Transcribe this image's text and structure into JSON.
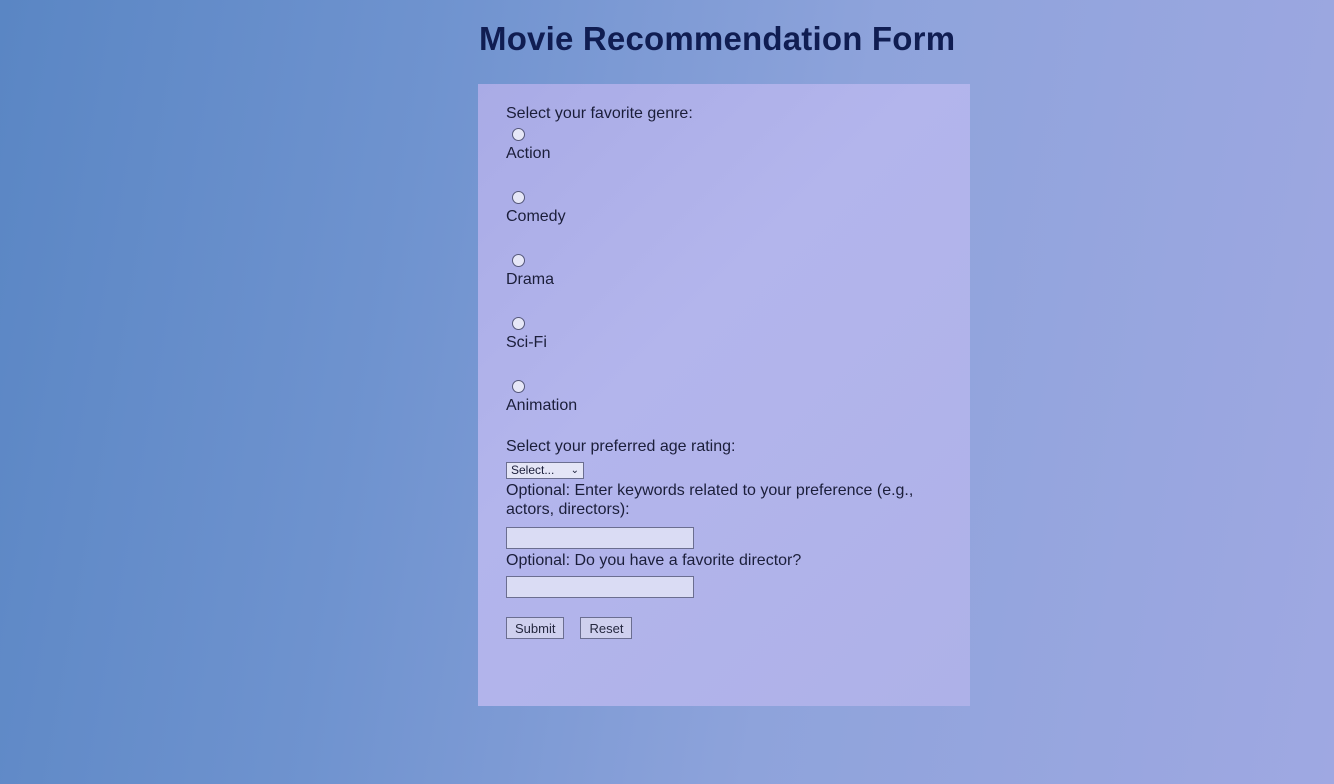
{
  "page": {
    "title": "Movie Recommendation Form"
  },
  "form": {
    "genre_heading": "Select your favorite genre:",
    "genres": [
      {
        "label": "Action",
        "selected": false
      },
      {
        "label": "Comedy",
        "selected": false
      },
      {
        "label": "Drama",
        "selected": false
      },
      {
        "label": "Sci-Fi",
        "selected": false
      },
      {
        "label": "Animation",
        "selected": false
      }
    ],
    "age_heading": "Select your preferred age rating:",
    "age_select_value": "Select...",
    "keywords_label": "Optional: Enter keywords related to your preference (e.g., actors, directors):",
    "keywords_value": "",
    "director_label": "Optional: Do you have a favorite director?",
    "director_value": "",
    "submit_label": "Submit",
    "reset_label": "Reset"
  },
  "colors": {
    "title": "#101d52",
    "card_background": "#b0b2ea"
  },
  "icons": {
    "select_arrow": "chevron-down-icon"
  }
}
